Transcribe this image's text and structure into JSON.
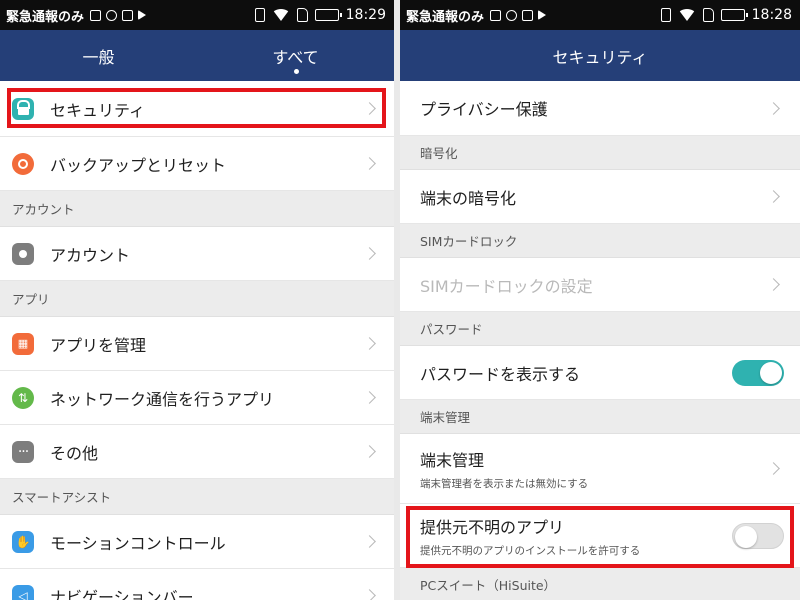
{
  "left": {
    "status": {
      "carrier": "緊急通報のみ",
      "time": "18:29"
    },
    "tabs": [
      {
        "label": "一般",
        "active": false
      },
      {
        "label": "すべて",
        "active": true
      }
    ],
    "items": {
      "security": "セキュリティ",
      "backup": "バックアップとリセット",
      "section_account": "アカウント",
      "account": "アカウント",
      "section_apps": "アプリ",
      "manage_apps": "アプリを管理",
      "network_apps": "ネットワーク通信を行うアプリ",
      "other": "その他",
      "section_smart": "スマートアシスト",
      "motion": "モーションコントロール",
      "navbar": "ナビゲーションバー"
    },
    "icons": {
      "security": "lock-icon",
      "backup": "backup-icon",
      "account": "account-icon",
      "manage_apps": "apps-grid-icon",
      "network_apps": "network-icon",
      "other": "more-icon",
      "motion": "hand-icon",
      "navbar": "navigation-icon"
    }
  },
  "right": {
    "status": {
      "carrier": "緊急通報のみ",
      "time": "18:28"
    },
    "title": "セキュリティ",
    "items": {
      "privacy": "プライバシー保護",
      "section_encryption": "暗号化",
      "encrypt_device": "端末の暗号化",
      "section_sim": "SIMカードロック",
      "sim_settings": "SIMカードロックの設定",
      "section_password": "パスワード",
      "show_password": "パスワードを表示する",
      "section_device_admin": "端末管理",
      "device_admin": "端末管理",
      "device_admin_sub": "端末管理者を表示または無効にする",
      "unknown_sources": "提供元不明のアプリ",
      "unknown_sources_sub": "提供元不明のアプリのインストールを許可する",
      "section_pcsuite": "PCスイート（HiSuite）"
    },
    "toggles": {
      "show_password": true,
      "unknown_sources": false
    }
  },
  "colors": {
    "appbar": "#253f78",
    "toggle_on": "#2fb2b0",
    "highlight": "#e4151a"
  }
}
